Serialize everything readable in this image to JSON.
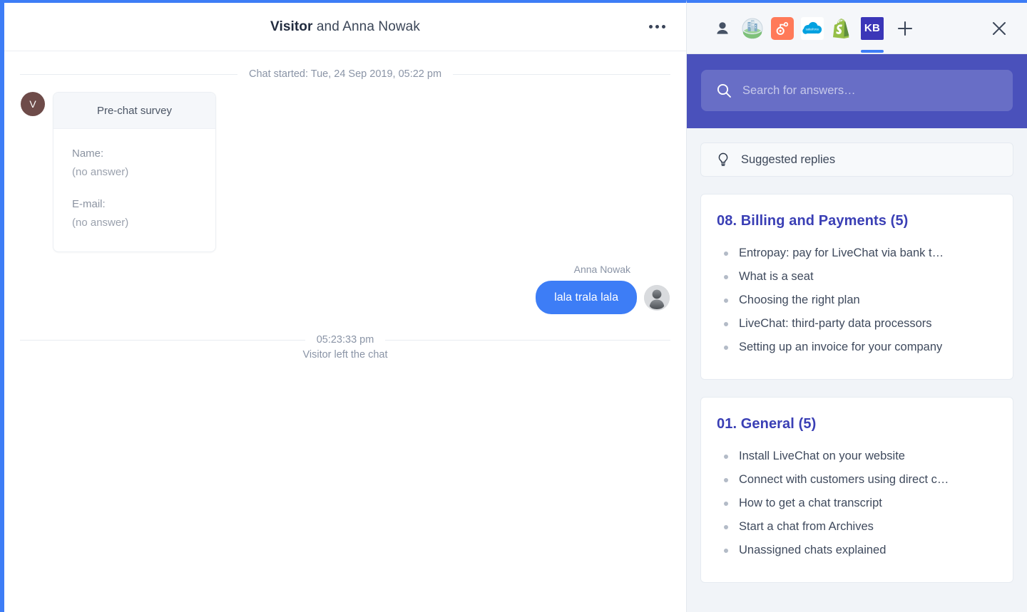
{
  "chat": {
    "header": {
      "title_strong": "Visitor",
      "title_rest": " and Anna Nowak",
      "more_label": "•••"
    },
    "started_divider": "Chat started: Tue, 24 Sep 2019, 05:22 pm",
    "survey": {
      "avatar_initial": "V",
      "card_title": "Pre-chat survey",
      "fields": [
        {
          "label": "Name:",
          "value": "(no answer)"
        },
        {
          "label": "E-mail:",
          "value": "(no answer)"
        }
      ]
    },
    "agent_message": {
      "author": "Anna Nowak",
      "text": "lala trala lala"
    },
    "leave_event": {
      "time": "05:23:33 pm",
      "text": "Visitor left the chat"
    }
  },
  "side_panel": {
    "app_bar": {
      "icons": [
        {
          "name": "visitor-profile-icon",
          "label": ""
        },
        {
          "name": "company-info-icon",
          "label": ""
        },
        {
          "name": "hubspot-icon",
          "label": ""
        },
        {
          "name": "salesforce-icon",
          "label": "salesforce"
        },
        {
          "name": "shopify-icon",
          "label": ""
        },
        {
          "name": "knowledge-base-icon",
          "label": "KB"
        }
      ],
      "add_label": "+",
      "close_label": "✕"
    },
    "search": {
      "placeholder": "Search for answers…",
      "value": "",
      "icon": "search-icon"
    },
    "suggested": {
      "icon": "lightbulb-icon",
      "label": "Suggested replies"
    },
    "categories": [
      {
        "title": "08. Billing and Payments (5)",
        "articles": [
          "Entropay: pay for LiveChat via bank t…",
          "What is a seat",
          "Choosing the right plan",
          "LiveChat: third-party data processors",
          "Setting up an invoice for your company"
        ]
      },
      {
        "title": "01. General (5)",
        "articles": [
          "Install LiveChat on your website",
          "Connect with customers using direct c…",
          "How to get a chat transcript",
          "Start a chat from Archives",
          "Unassigned chats explained"
        ]
      }
    ]
  },
  "colors": {
    "accent_blue": "#3d7df6",
    "search_indigo": "#4a51bb",
    "kb_title_blue": "#3a3fb5",
    "kb_icon_bg": "#3b36b8",
    "panel_bg": "#f1f4f8",
    "visitor_avatar": "#6e4b49"
  }
}
